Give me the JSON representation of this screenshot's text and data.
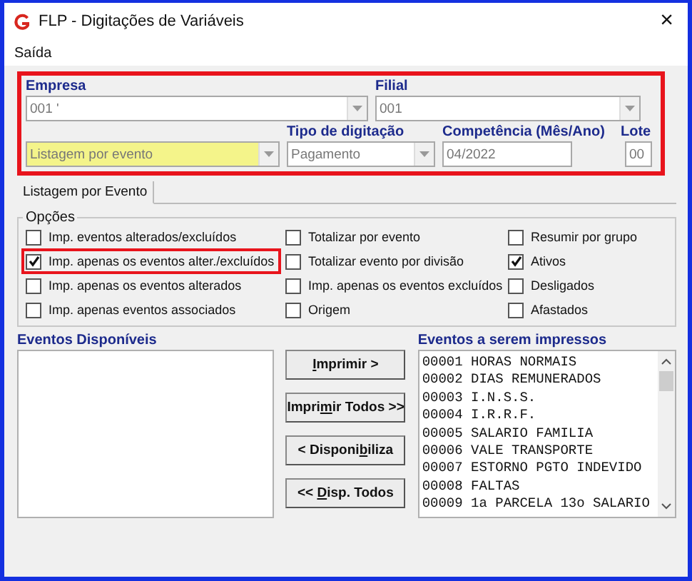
{
  "window": {
    "title": "FLP - Digitações de Variáveis",
    "close": "×"
  },
  "menu": [
    "Saída"
  ],
  "header": {
    "highlighted": true,
    "empresa": {
      "label": "Empresa",
      "value": "001 '"
    },
    "filial": {
      "label": "Filial",
      "value": "001"
    },
    "listagem": {
      "value": "Listagem por evento",
      "highlighted": true
    },
    "tipo": {
      "label": "Tipo de digitação",
      "value": "Pagamento"
    },
    "competencia": {
      "label": "Competência (Mês/Ano)",
      "value": "04/2022"
    },
    "lote": {
      "label": "Lote",
      "value": "00"
    }
  },
  "tabs": [
    {
      "label": "Listagem por Evento",
      "selected": true
    }
  ],
  "options_group": {
    "title": "Opções",
    "options": [
      {
        "label": "Imp. eventos alterados/excluídos",
        "checked": false,
        "highlighted": false
      },
      {
        "label": "Totalizar por evento",
        "checked": false,
        "highlighted": false
      },
      {
        "label": "Resumir por grupo",
        "checked": false,
        "highlighted": false
      },
      {
        "label": "Imp. apenas os eventos alter./excluídos",
        "checked": true,
        "highlighted": true
      },
      {
        "label": "Totalizar evento por divisão",
        "checked": false,
        "highlighted": false
      },
      {
        "label": "Ativos",
        "checked": true,
        "highlighted": false
      },
      {
        "label": "Imp. apenas os eventos alterados",
        "checked": false,
        "highlighted": false
      },
      {
        "label": "Imp. apenas os eventos excluídos",
        "checked": false,
        "highlighted": false
      },
      {
        "label": "Desligados",
        "checked": false,
        "highlighted": false
      },
      {
        "label": "Imp. apenas  eventos associados",
        "checked": false,
        "highlighted": false
      },
      {
        "label": "Origem",
        "checked": false,
        "highlighted": false
      },
      {
        "label": "Afastados",
        "checked": false,
        "highlighted": false
      }
    ]
  },
  "available": {
    "label": "Eventos Disponíveis"
  },
  "buttons": [
    {
      "key": "I",
      "after": "mprimir >"
    },
    {
      "before": "Impri",
      "key": "m",
      "after": "ir Todos >>"
    },
    {
      "before": "< Disponi",
      "key": "b",
      "after": "iliza"
    },
    {
      "before": "<< ",
      "key": "D",
      "after": "isp. Todos"
    }
  ],
  "selected_events": {
    "label": "Eventos a serem impressos",
    "items": [
      "00001 HORAS NORMAIS",
      "00002 DIAS REMUNERADOS",
      "00003 I.N.S.S.",
      "00004 I.R.R.F.",
      "00005 SALARIO FAMILIA",
      "00006 VALE TRANSPORTE",
      "00007 ESTORNO PGTO INDEVIDO",
      "00008 FALTAS",
      "00009 1a PARCELA 13o SALARIO"
    ]
  }
}
